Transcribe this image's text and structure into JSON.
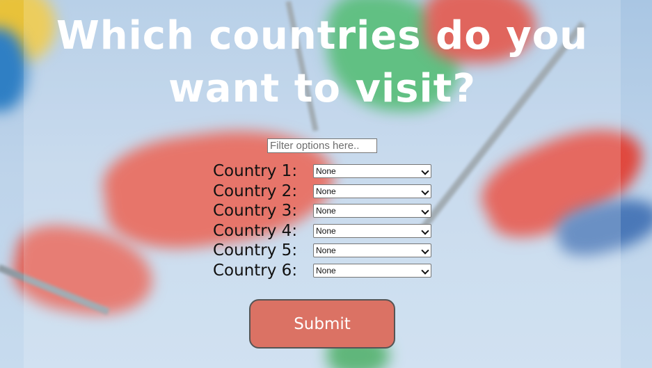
{
  "page": {
    "title": "Which countries do you want to visit?"
  },
  "filter": {
    "placeholder": "Filter options here.."
  },
  "countries": [
    {
      "label": "Country 1:",
      "value": "None"
    },
    {
      "label": "Country 2:",
      "value": "None"
    },
    {
      "label": "Country 3:",
      "value": "None"
    },
    {
      "label": "Country 4:",
      "value": "None"
    },
    {
      "label": "Country 5:",
      "value": "None"
    },
    {
      "label": "Country 6:",
      "value": "None"
    }
  ],
  "submit": {
    "label": "Submit"
  },
  "colors": {
    "submit_background": "#db7264",
    "title_text": "#ffffff",
    "label_text": "#111111"
  },
  "icons": {
    "select_arrow": "chevron-down-icon"
  }
}
